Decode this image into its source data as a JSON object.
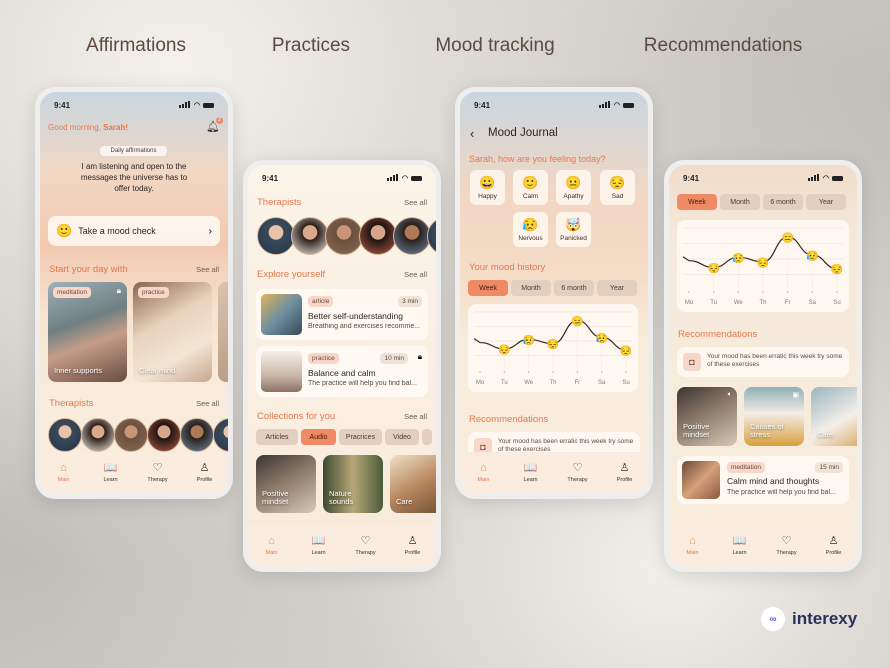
{
  "titles": [
    "Affirmations",
    "Practices",
    "Mood tracking",
    "Recommendations"
  ],
  "status_time": "9:41",
  "nav": [
    {
      "label": "Main",
      "icon": "home-icon"
    },
    {
      "label": "Learn",
      "icon": "book-icon"
    },
    {
      "label": "Therapy",
      "icon": "hearts-icon"
    },
    {
      "label": "Profile",
      "icon": "user-icon"
    }
  ],
  "see_all": "See all",
  "affirmations": {
    "greeting": "Good morning, ",
    "name": "Sarah!",
    "notification_count": "2",
    "pill": "Daily affirmations",
    "text": "I am listening and open to the messages the universe has to offer today.",
    "mood_check": "Take a mood check",
    "start_title": "Start your day with",
    "cards": [
      {
        "tag": "meditation",
        "title": "Inner supports",
        "locked": true
      },
      {
        "tag": "practice",
        "title": "Clear mind"
      }
    ],
    "therapists_title": "Therapists"
  },
  "practices": {
    "therapists_title": "Therapists",
    "explore_title": "Explore yourself",
    "items": [
      {
        "tag": "article",
        "duration": "3 min",
        "title": "Better self-understanding",
        "subtitle": "Breathing and exercises recomme..."
      },
      {
        "tag": "practice",
        "duration": "10 min",
        "title": "Balance and calm",
        "subtitle": "The practice will help you find bal...",
        "locked": true
      }
    ],
    "collections_title": "Collections for you",
    "chips": [
      {
        "label": "Articles"
      },
      {
        "label": "Audio",
        "active": true
      },
      {
        "label": "Pracrices"
      },
      {
        "label": "Video"
      }
    ],
    "media": [
      {
        "title": "Positive mindset"
      },
      {
        "title": "Nature sounds"
      },
      {
        "title": "Care"
      }
    ]
  },
  "mood": {
    "title": "Mood Journal",
    "question": "Sarah, how are you feeling today?",
    "moods": [
      {
        "emoji": "😀",
        "label": "Happy"
      },
      {
        "emoji": "🙂",
        "label": "Calm"
      },
      {
        "emoji": "😐",
        "label": "Apathy"
      },
      {
        "emoji": "😔",
        "label": "Sad"
      },
      {
        "emoji": "😥",
        "label": "Nervous"
      },
      {
        "emoji": "🤯",
        "label": "Panicked"
      }
    ],
    "history_title": "Your mood history",
    "tabs": [
      {
        "label": "Week",
        "active": true
      },
      {
        "label": "Month"
      },
      {
        "label": "6 month"
      },
      {
        "label": "Year"
      }
    ],
    "recommendations_title": "Recommendations",
    "rec_text": "Your mood has been erratic this week try some of these exercises"
  },
  "mood_chart": {
    "type": "line",
    "days": [
      "Mo",
      "Tu",
      "We",
      "Th",
      "Fr",
      "Sa",
      "Su"
    ],
    "values": [
      2.6,
      2.0,
      2.9,
      2.5,
      4.7,
      3.1,
      1.9
    ],
    "emojis": [
      null,
      "😔",
      "😥",
      "😔",
      "😑",
      "😥",
      "😔"
    ],
    "ylim": [
      0,
      5.5
    ],
    "grid": true,
    "line_color": "#3a2520"
  },
  "recommendations": {
    "tabs": [
      {
        "label": "Week",
        "active": true
      },
      {
        "label": "Month"
      },
      {
        "label": "6 month"
      },
      {
        "label": "Year"
      }
    ],
    "title": "Recommendations",
    "rec_text": "Your mood has been erratic this week try some of these exercises",
    "media": [
      {
        "title": "Positive mindset"
      },
      {
        "title": "Causes of stress"
      },
      {
        "title": "Care"
      }
    ],
    "item": {
      "tag": "meditation",
      "duration": "15 min",
      "title": "Calm mind and thoughts",
      "subtitle": "The practice will help you find bal..."
    }
  },
  "logo": "interexy",
  "colors": {
    "accent": "#e5774f",
    "tab_active": "#f08a64",
    "background": "#f8ecdc"
  }
}
